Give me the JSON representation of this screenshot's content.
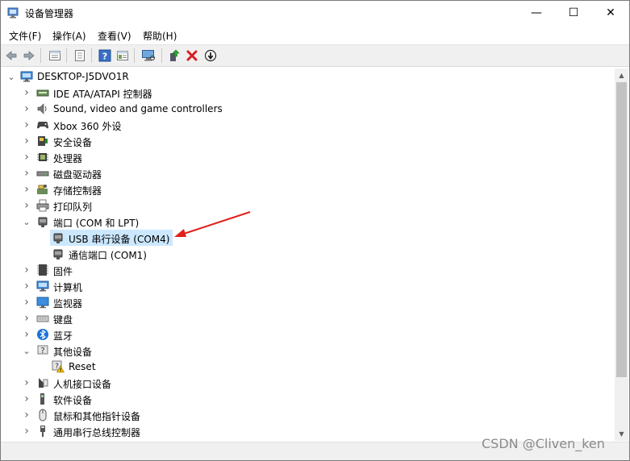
{
  "window": {
    "title": "设备管理器",
    "controls": {
      "minimize": "—",
      "maximize": "☐",
      "close": "✕"
    }
  },
  "menu": [
    {
      "label": "文件(F)"
    },
    {
      "label": "操作(A)"
    },
    {
      "label": "查看(V)"
    },
    {
      "label": "帮助(H)"
    }
  ],
  "toolbar": {
    "icons": [
      "back-icon",
      "forward-icon",
      "properties-icon",
      "show-hide-icon",
      "help-icon",
      "console-tree-icon",
      "scan-hardware-icon",
      "update-driver-icon",
      "uninstall-icon",
      "disable-icon"
    ]
  },
  "tree": {
    "root": "DESKTOP-J5DVO1R",
    "items": [
      {
        "label": "IDE ATA/ATAPI 控制器",
        "icon": "ide-icon",
        "expanded": false
      },
      {
        "label": "Sound, video and game controllers",
        "icon": "speaker-icon",
        "expanded": false
      },
      {
        "label": "Xbox 360 外设",
        "icon": "gamepad-icon",
        "expanded": false
      },
      {
        "label": "安全设备",
        "icon": "security-device-icon",
        "expanded": false
      },
      {
        "label": "处理器",
        "icon": "processor-icon",
        "expanded": false
      },
      {
        "label": "磁盘驱动器",
        "icon": "disk-drive-icon",
        "expanded": false
      },
      {
        "label": "存储控制器",
        "icon": "storage-controller-icon",
        "expanded": false
      },
      {
        "label": "打印队列",
        "icon": "printer-icon",
        "expanded": false
      },
      {
        "label": "端口 (COM 和 LPT)",
        "icon": "port-icon",
        "expanded": true,
        "children": [
          {
            "label": "USB 串行设备 (COM4)",
            "icon": "port-icon",
            "selected": true
          },
          {
            "label": "通信端口 (COM1)",
            "icon": "port-icon",
            "selected": false
          }
        ]
      },
      {
        "label": "固件",
        "icon": "firmware-icon",
        "expanded": false
      },
      {
        "label": "计算机",
        "icon": "computer-icon",
        "expanded": false
      },
      {
        "label": "监视器",
        "icon": "monitor-icon",
        "expanded": false
      },
      {
        "label": "键盘",
        "icon": "keyboard-icon",
        "expanded": false
      },
      {
        "label": "蓝牙",
        "icon": "bluetooth-icon",
        "expanded": false
      },
      {
        "label": "其他设备",
        "icon": "unknown-device-icon",
        "expanded": true,
        "children": [
          {
            "label": "Reset",
            "icon": "warning-device-icon",
            "selected": false
          }
        ]
      },
      {
        "label": "人机接口设备",
        "icon": "hid-icon",
        "expanded": false
      },
      {
        "label": "软件设备",
        "icon": "software-device-icon",
        "expanded": false
      },
      {
        "label": "鼠标和其他指针设备",
        "icon": "mouse-icon",
        "expanded": false
      },
      {
        "label": "通用串行总线控制器",
        "icon": "usb-icon",
        "expanded": false
      }
    ]
  },
  "watermark": "CSDN @Cliven_ken",
  "colors": {
    "selection": "#cce8ff",
    "annotation_arrow": "#e0201b",
    "toolbar_bg": "#f0f0f0"
  }
}
